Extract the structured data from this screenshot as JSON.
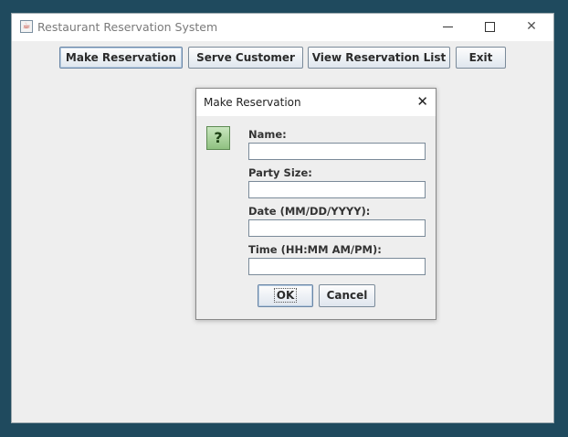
{
  "window": {
    "title": "Restaurant Reservation System",
    "controls": {
      "minimize": "",
      "maximize": "",
      "close": "✕"
    }
  },
  "toolbar": {
    "buttons": [
      {
        "label": "Make Reservation"
      },
      {
        "label": "Serve Customer"
      },
      {
        "label": "View Reservation List"
      },
      {
        "label": "Exit"
      }
    ]
  },
  "dialog": {
    "title": "Make Reservation",
    "close": "✕",
    "icon_glyph": "?",
    "icon_name": "question-icon",
    "fields": [
      {
        "label": "Name:",
        "value": ""
      },
      {
        "label": "Party Size:",
        "value": ""
      },
      {
        "label": "Date (MM/DD/YYYY):",
        "value": ""
      },
      {
        "label": "Time (HH:MM AM/PM):",
        "value": ""
      }
    ],
    "ok_label": "OK",
    "cancel_label": "Cancel"
  },
  "colors": {
    "desktop": "#1f4a5e",
    "window_bg": "#eeeeee",
    "icon_green": "#8fc180"
  }
}
